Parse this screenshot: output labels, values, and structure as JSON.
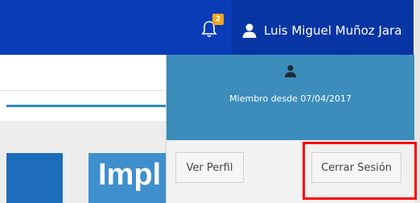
{
  "header": {
    "notification_count": "2",
    "user_name": "Luis Miguel Muñoz Jara",
    "icons": {
      "bell": "bell-icon",
      "user": "user-icon"
    }
  },
  "page": {
    "banner_text": "Impl"
  },
  "user_dropdown": {
    "member_since": "Miembro desde 07/04/2017",
    "profile_button": "Ver Perfil",
    "logout_button": "Cerrar Sesión",
    "icon": "user-silhouette-icon"
  },
  "colors": {
    "topbar": "#0a3cb8",
    "dropdown_header": "#3c8dbc",
    "badge": "#f0a71d",
    "highlight": "#ff0000"
  }
}
